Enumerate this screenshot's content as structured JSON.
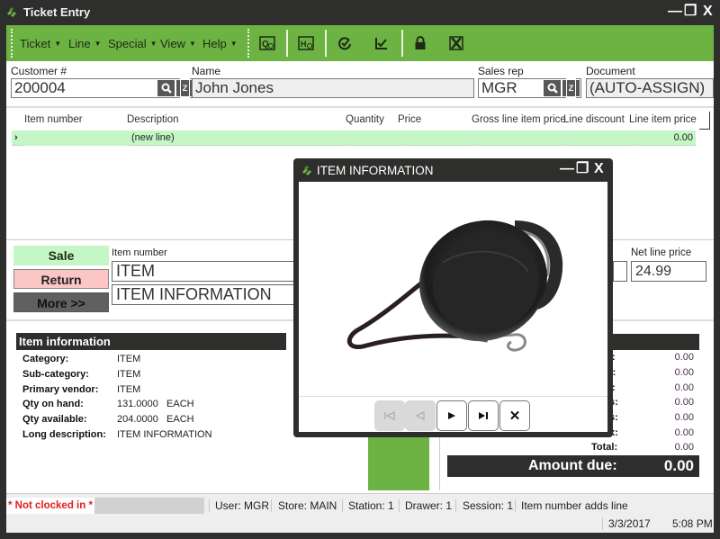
{
  "window": {
    "title": "Ticket Entry",
    "controls": {
      "minimize": "—",
      "restore": "❐",
      "close": "X"
    }
  },
  "toolbar": {
    "menus": [
      {
        "label": "Ticket",
        "accel": "T"
      },
      {
        "label": "Line",
        "accel": "L"
      },
      {
        "label": "Special",
        "accel": "S"
      },
      {
        "label": "View",
        "accel": "V"
      },
      {
        "label": "Help",
        "accel": "H"
      }
    ],
    "icons": [
      "quantity-icon",
      "history-icon",
      "check-icon",
      "checkmark-icon",
      "lock-icon",
      "void-icon"
    ]
  },
  "header": {
    "customer_label": "Customer #",
    "customer_value": "200004",
    "name_label": "Name",
    "name_value": "John Jones",
    "salesrep_label": "Sales rep",
    "salesrep_value": "MGR",
    "document_label": "Document",
    "document_value": "(AUTO-ASSIGN)",
    "lookup_glyph": "Q",
    "zoom_glyph": "Z"
  },
  "grid": {
    "columns": [
      "Item number",
      "Description",
      "Quantity",
      "Price",
      "Gross line item price",
      "Line discount",
      "Line item price"
    ],
    "rows": [
      {
        "marker": "›",
        "item_number": "",
        "description": "(new line)",
        "quantity": "",
        "price": "",
        "gross": "",
        "discount": "",
        "line_price": "0.00"
      }
    ]
  },
  "edit": {
    "sale_label": "Sale",
    "return_label": "Return",
    "more_label": "More >>",
    "item_number_label": "Item number",
    "item_number_value": "ITEM",
    "description_value": "ITEM INFORMATION",
    "net_price_label": "Net line price",
    "net_price_value": "24.99"
  },
  "item_info": {
    "heading": "Item information",
    "rows": [
      {
        "label": "Category:",
        "value": "ITEM"
      },
      {
        "label": "Sub-category:",
        "value": "ITEM"
      },
      {
        "label": "Primary vendor:",
        "value": "ITEM"
      },
      {
        "label": "Qty on hand:",
        "value": "131.0000   EACH"
      },
      {
        "label": "Qty available:",
        "value": "204.0000   EACH"
      },
      {
        "label": "Long description:",
        "value": "ITEM INFORMATION"
      }
    ]
  },
  "totals": {
    "rows": [
      {
        "label": "l:",
        "value": "0.00"
      },
      {
        "label": "t:",
        "value": "0.00"
      },
      {
        "label": "l:",
        "value": "0.00"
      },
      {
        "label": "s:",
        "value": "0.00"
      },
      {
        "label": "s:",
        "value": "0.00"
      },
      {
        "label": "x:",
        "value": "0.00"
      },
      {
        "label": "Total:",
        "value": "0.00"
      }
    ],
    "amount_due_label": "Amount due:",
    "amount_due_value": "0.00"
  },
  "statusbar": {
    "clock_status": "* Not clocked in *",
    "user": "User: MGR",
    "store": "Store: MAIN",
    "station": "Station: 1",
    "drawer": "Drawer: 1",
    "session": "Session: 1",
    "mode": "Item number adds line",
    "date": "3/3/2017",
    "time": "5:08 PM"
  },
  "popup": {
    "title": "ITEM INFORMATION",
    "image_alt": "Retractable dog leash",
    "nav": {
      "first": "⏮",
      "prev": "◁",
      "next": "▶",
      "last": "▶|",
      "close": "✕"
    }
  },
  "colors": {
    "accent_green": "#6db344",
    "frame_dark": "#2e2f2d",
    "row_green": "#c4f7c5",
    "return_pink": "#fcc6c6",
    "alert_red": "#e31c1c"
  }
}
